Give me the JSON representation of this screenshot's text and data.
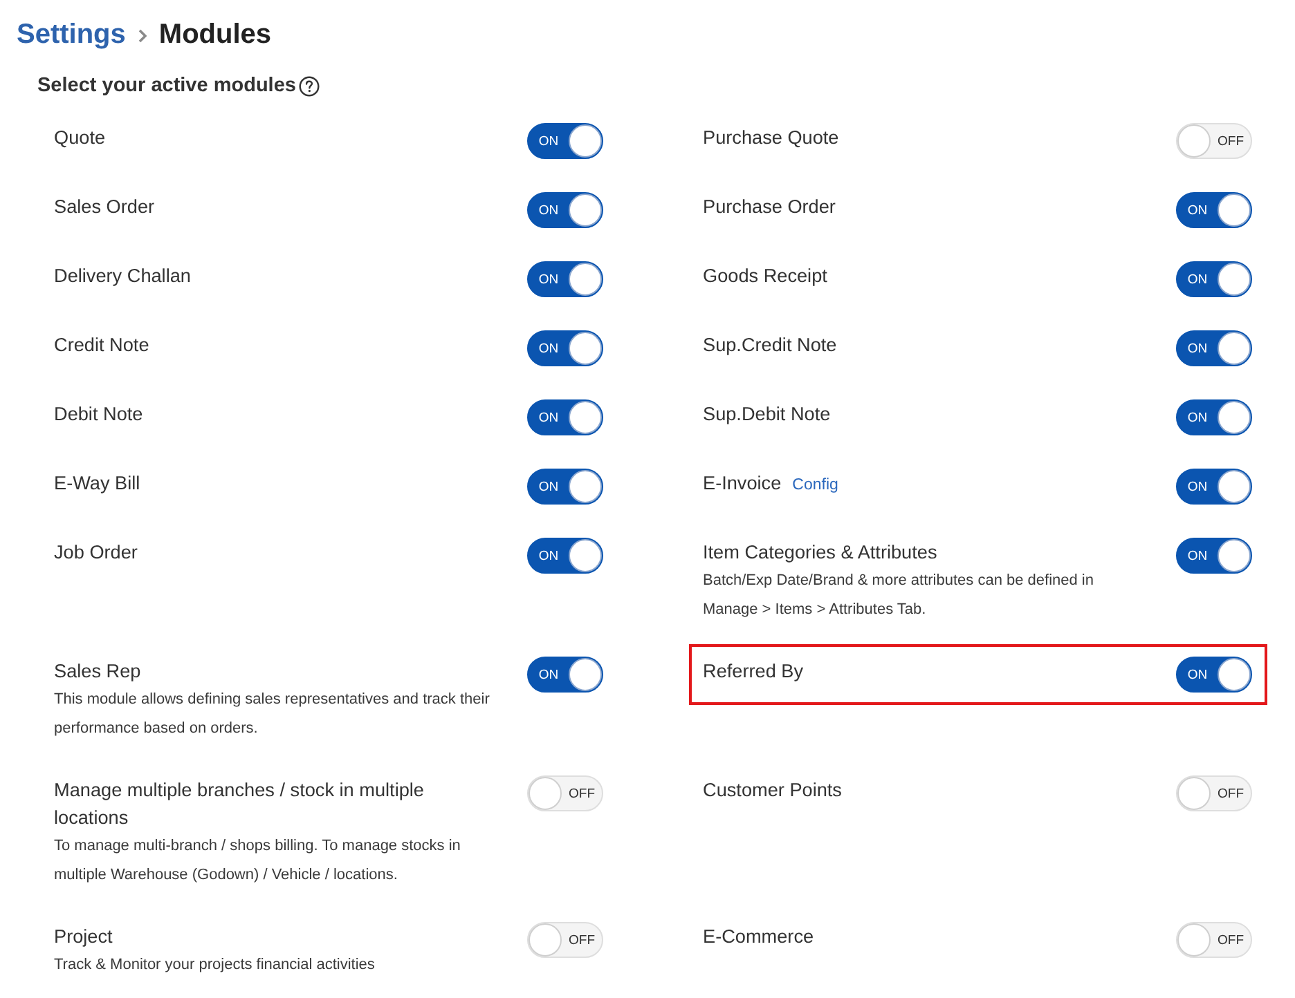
{
  "breadcrumb": {
    "parent": "Settings",
    "current": "Modules"
  },
  "section_title": "Select your active modules",
  "modules": [
    {
      "name": "Quote",
      "on": true,
      "toggle_text": "ON",
      "highlighted": false
    },
    {
      "name": "Purchase Quote",
      "on": false,
      "toggle_text": "OFF",
      "highlighted": false
    },
    {
      "name": "Sales Order",
      "on": true,
      "toggle_text": "ON",
      "highlighted": false
    },
    {
      "name": "Purchase Order",
      "on": true,
      "toggle_text": "ON",
      "highlighted": false
    },
    {
      "name": "Delivery Challan",
      "on": true,
      "toggle_text": "ON",
      "highlighted": false
    },
    {
      "name": "Goods Receipt",
      "on": true,
      "toggle_text": "ON",
      "highlighted": false
    },
    {
      "name": "Credit Note",
      "on": true,
      "toggle_text": "ON",
      "highlighted": false
    },
    {
      "name": "Sup.Credit Note",
      "on": true,
      "toggle_text": "ON",
      "highlighted": false
    },
    {
      "name": "Debit Note",
      "on": true,
      "toggle_text": "ON",
      "highlighted": false
    },
    {
      "name": "Sup.Debit Note",
      "on": true,
      "toggle_text": "ON",
      "highlighted": false
    },
    {
      "name": "E-Way Bill",
      "on": true,
      "toggle_text": "ON",
      "highlighted": false
    },
    {
      "name": "E-Invoice",
      "link": "Config",
      "on": true,
      "toggle_text": "ON",
      "highlighted": false
    },
    {
      "name": "Job Order",
      "on": true,
      "toggle_text": "ON",
      "highlighted": false
    },
    {
      "name": "Item Categories & Attributes",
      "description": "Batch/Exp Date/Brand & more attributes can be defined in Manage > Items > Attributes Tab.",
      "on": true,
      "toggle_text": "ON",
      "highlighted": false
    },
    {
      "name": "Sales Rep",
      "description": "This module allows defining sales representatives and track their performance based on orders.",
      "on": true,
      "toggle_text": "ON",
      "highlighted": false
    },
    {
      "name": "Referred By",
      "on": true,
      "toggle_text": "ON",
      "highlighted": true
    },
    {
      "name": "Manage multiple branches / stock in multiple locations",
      "description": "To manage multi-branch / shops billing. To manage stocks in multiple Warehouse (Godown) / Vehicle / locations.",
      "on": false,
      "toggle_text": "OFF",
      "highlighted": false
    },
    {
      "name": "Customer Points",
      "on": false,
      "toggle_text": "OFF",
      "highlighted": false
    },
    {
      "name": "Project",
      "description": "Track & Monitor your projects financial activities",
      "on": false,
      "toggle_text": "OFF",
      "highlighted": false
    },
    {
      "name": "E-Commerce",
      "on": false,
      "toggle_text": "OFF",
      "highlighted": false
    }
  ]
}
